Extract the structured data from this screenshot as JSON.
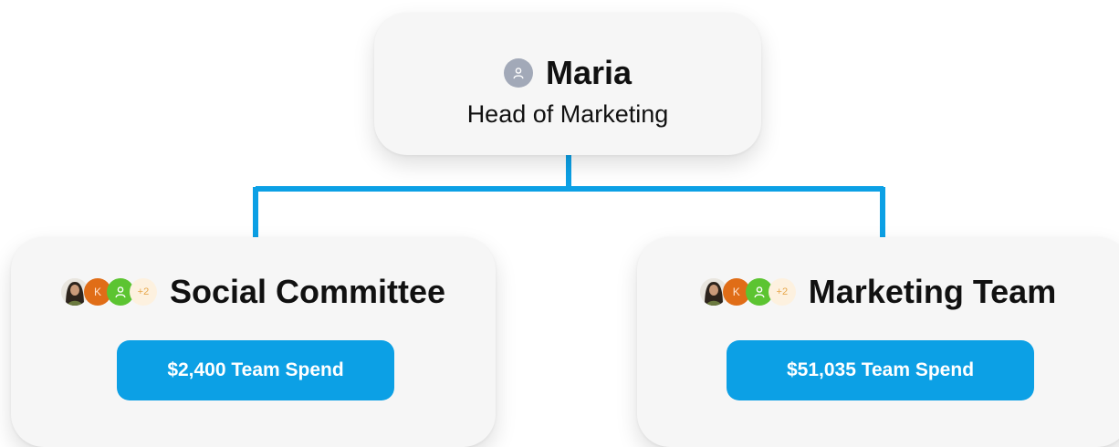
{
  "root": {
    "avatar_icon": "person-icon",
    "name": "Maria",
    "role": "Head of Marketing"
  },
  "colors": {
    "connector": "#0ca0e5",
    "button": "#0ca0e5",
    "card": "#f6f6f6"
  },
  "teams": [
    {
      "title": "Social Committee",
      "avatars": [
        {
          "kind": "photo",
          "label": ""
        },
        {
          "kind": "initial",
          "label": "K"
        },
        {
          "kind": "icon",
          "icon": "person-icon"
        },
        {
          "kind": "more",
          "label": "+2"
        }
      ],
      "spend_label": "$2,400 Team Spend"
    },
    {
      "title": "Marketing Team",
      "avatars": [
        {
          "kind": "photo",
          "label": ""
        },
        {
          "kind": "initial",
          "label": "K"
        },
        {
          "kind": "icon",
          "icon": "person-icon"
        },
        {
          "kind": "more",
          "label": "+2"
        }
      ],
      "spend_label": "$51,035 Team Spend"
    }
  ]
}
